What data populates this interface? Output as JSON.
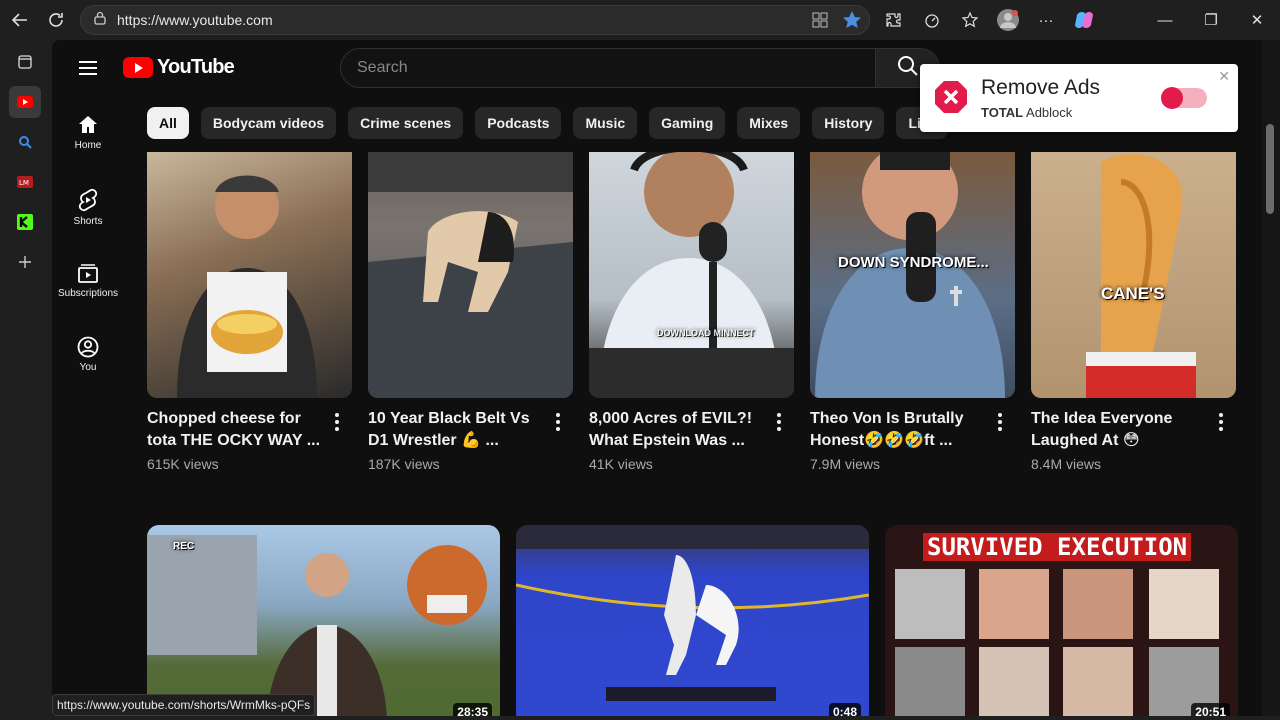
{
  "browser": {
    "url": "https://www.youtube.com",
    "status_url": "https://www.youtube.com/shorts/WrmMks-pQFs"
  },
  "tabstrip": {
    "items": [
      "tab-actions-icon",
      "youtube-tab",
      "search-tab",
      "lm-tab",
      "k-tab",
      "new-tab"
    ]
  },
  "youtube": {
    "logo_text": "YouTube",
    "search_placeholder": "Search",
    "chips": [
      "All",
      "Bodycam videos",
      "Crime scenes",
      "Podcasts",
      "Music",
      "Gaming",
      "Mixes",
      "History",
      "Live"
    ],
    "guide": [
      {
        "label": "Home",
        "icon": "home-icon"
      },
      {
        "label": "Shorts",
        "icon": "shorts-icon"
      },
      {
        "label": "Subscriptions",
        "icon": "subscriptions-icon"
      },
      {
        "label": "You",
        "icon": "you-icon"
      }
    ],
    "shorts": [
      {
        "title": "Chopped cheese for tota THE OCKY WAY ...",
        "views": "615K views",
        "overlay": ""
      },
      {
        "title": "10 Year Black Belt Vs D1 Wrestler 💪 ...",
        "views": "187K views",
        "overlay": ""
      },
      {
        "title": "8,000 Acres of EVIL?! What Epstein Was ...",
        "views": "41K views",
        "overlay": "DOWNLOAD MINNECT"
      },
      {
        "title": "Theo Von Is Brutally Honest🤣🤣🤣ft ...",
        "views": "7.9M views",
        "overlay": "DOWN SYNDROME..."
      },
      {
        "title": "The Idea Everyone Laughed At 😳",
        "views": "8.4M views",
        "overlay": "CANE'S"
      }
    ],
    "videos": [
      {
        "duration": "28:35",
        "overlay": "REC"
      },
      {
        "duration": "0:48",
        "overlay": ""
      },
      {
        "duration": "20:51",
        "overlay": "SURVIVED EXECUTION"
      }
    ]
  },
  "adblock_popup": {
    "title": "Remove Ads",
    "brand_bold": "TOTAL",
    "brand_rest": "Adblock"
  }
}
